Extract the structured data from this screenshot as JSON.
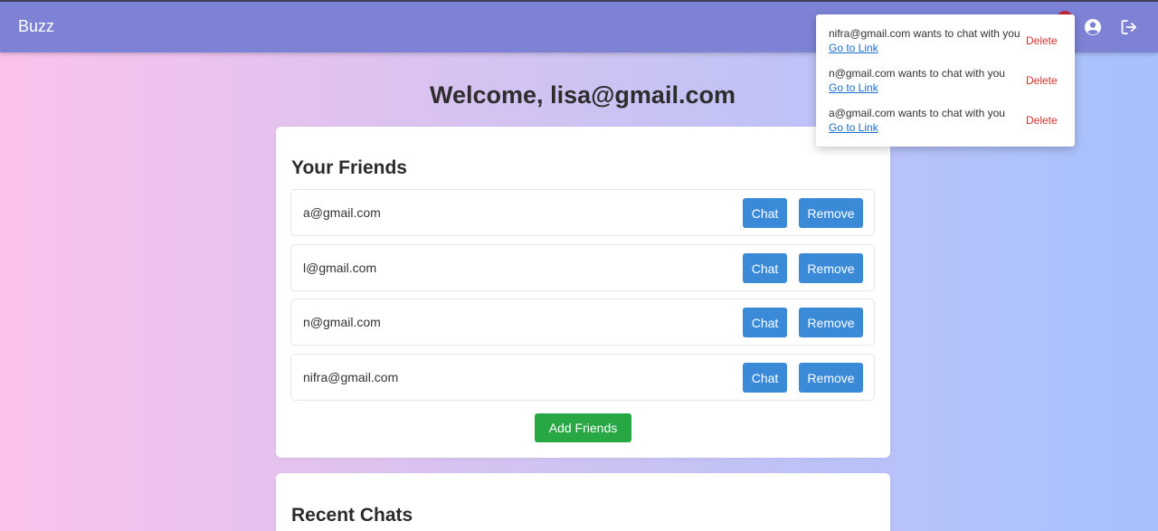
{
  "nav": {
    "brand": "Buzz",
    "icons": [
      "bell-icon",
      "user-circle-icon",
      "logout-icon"
    ]
  },
  "welcome": "Welcome, lisa@gmail.com",
  "friends": {
    "title": "Your Friends",
    "items": [
      {
        "email": "a@gmail.com",
        "chat": "Chat",
        "remove": "Remove"
      },
      {
        "email": "l@gmail.com",
        "chat": "Chat",
        "remove": "Remove"
      },
      {
        "email": "n@gmail.com",
        "chat": "Chat",
        "remove": "Remove"
      },
      {
        "email": "nifra@gmail.com",
        "chat": "Chat",
        "remove": "Remove"
      }
    ],
    "add_label": "Add Friends"
  },
  "recent": {
    "title": "Recent Chats"
  },
  "notifications": [
    {
      "message": "nifra@gmail.com wants to chat with you",
      "link": "Go to Link",
      "delete": "Delete"
    },
    {
      "message": "n@gmail.com wants to chat with you",
      "link": "Go to Link",
      "delete": "Delete"
    },
    {
      "message": "a@gmail.com wants to chat with you",
      "link": "Go to Link",
      "delete": "Delete"
    }
  ],
  "colors": {
    "navbar": "#7d82d5",
    "primary_button": "#3a8ad8",
    "success_button": "#27a844",
    "danger_text": "#d0342c",
    "badge": "#c0283a"
  }
}
